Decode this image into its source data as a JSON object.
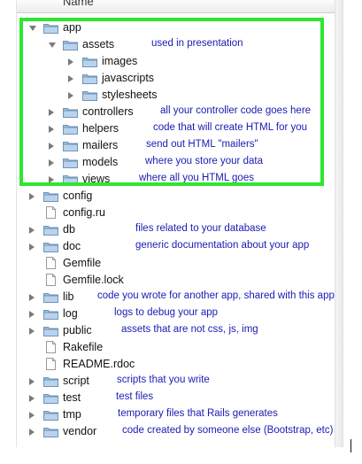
{
  "header": {
    "column_label": "Name"
  },
  "colors": {
    "highlight": "#2ee62e",
    "annotation": "#1a1ab4",
    "folder": "#8fb3d6"
  },
  "tree": [
    {
      "name": "app",
      "kind": "folder",
      "state": "open",
      "depth": 0,
      "note": "",
      "icon": "folder-icon"
    },
    {
      "name": "assets",
      "kind": "folder",
      "state": "open",
      "depth": 1,
      "note": "used in presentation",
      "icon": "folder-icon"
    },
    {
      "name": "images",
      "kind": "folder",
      "state": "closed",
      "depth": 2,
      "note": "",
      "icon": "folder-icon"
    },
    {
      "name": "javascripts",
      "kind": "folder",
      "state": "closed",
      "depth": 2,
      "note": "",
      "icon": "folder-icon"
    },
    {
      "name": "stylesheets",
      "kind": "folder",
      "state": "closed",
      "depth": 2,
      "note": "",
      "icon": "folder-icon"
    },
    {
      "name": "controllers",
      "kind": "folder",
      "state": "closed",
      "depth": 1,
      "note": "all your controller code goes here",
      "icon": "folder-icon"
    },
    {
      "name": "helpers",
      "kind": "folder",
      "state": "closed",
      "depth": 1,
      "note": "code that will create HTML for you",
      "icon": "folder-icon"
    },
    {
      "name": "mailers",
      "kind": "folder",
      "state": "closed",
      "depth": 1,
      "note": "send out HTML \"mailers\"",
      "icon": "folder-icon"
    },
    {
      "name": "models",
      "kind": "folder",
      "state": "closed",
      "depth": 1,
      "note": "where you store your data",
      "icon": "folder-icon"
    },
    {
      "name": "views",
      "kind": "folder",
      "state": "closed",
      "depth": 1,
      "note": "where all you HTML goes",
      "icon": "folder-icon"
    },
    {
      "name": "config",
      "kind": "folder",
      "state": "closed",
      "depth": 0,
      "note": "",
      "icon": "folder-icon"
    },
    {
      "name": "config.ru",
      "kind": "file",
      "state": "",
      "depth": 0,
      "note": "",
      "icon": "file-icon"
    },
    {
      "name": "db",
      "kind": "folder",
      "state": "closed",
      "depth": 0,
      "note": "files related to your database",
      "icon": "folder-icon"
    },
    {
      "name": "doc",
      "kind": "folder",
      "state": "closed",
      "depth": 0,
      "note": "generic documentation about your app",
      "icon": "folder-icon"
    },
    {
      "name": "Gemfile",
      "kind": "file",
      "state": "",
      "depth": 0,
      "note": "",
      "icon": "file-icon"
    },
    {
      "name": "Gemfile.lock",
      "kind": "file",
      "state": "",
      "depth": 0,
      "note": "",
      "icon": "file-icon"
    },
    {
      "name": "lib",
      "kind": "folder",
      "state": "closed",
      "depth": 0,
      "note": "code you wrote for another app, shared with this app",
      "icon": "folder-icon"
    },
    {
      "name": "log",
      "kind": "folder",
      "state": "closed",
      "depth": 0,
      "note": "logs to debug your app",
      "icon": "folder-icon"
    },
    {
      "name": "public",
      "kind": "folder",
      "state": "closed",
      "depth": 0,
      "note": "assets that are not css, js, img",
      "icon": "folder-icon"
    },
    {
      "name": "Rakefile",
      "kind": "file",
      "state": "",
      "depth": 0,
      "note": "",
      "icon": "file-icon"
    },
    {
      "name": "README.rdoc",
      "kind": "file",
      "state": "",
      "depth": 0,
      "note": "",
      "icon": "file-icon"
    },
    {
      "name": "script",
      "kind": "folder",
      "state": "closed",
      "depth": 0,
      "note": "scripts that you write",
      "icon": "folder-icon"
    },
    {
      "name": "test",
      "kind": "folder",
      "state": "closed",
      "depth": 0,
      "note": "test files",
      "icon": "folder-icon"
    },
    {
      "name": "tmp",
      "kind": "folder",
      "state": "closed",
      "depth": 0,
      "note": "temporary files that Rails generates",
      "icon": "folder-icon"
    },
    {
      "name": "vendor",
      "kind": "folder",
      "state": "closed",
      "depth": 0,
      "note": "code created by someone else (Bootstrap, etc)",
      "icon": "folder-icon"
    }
  ]
}
